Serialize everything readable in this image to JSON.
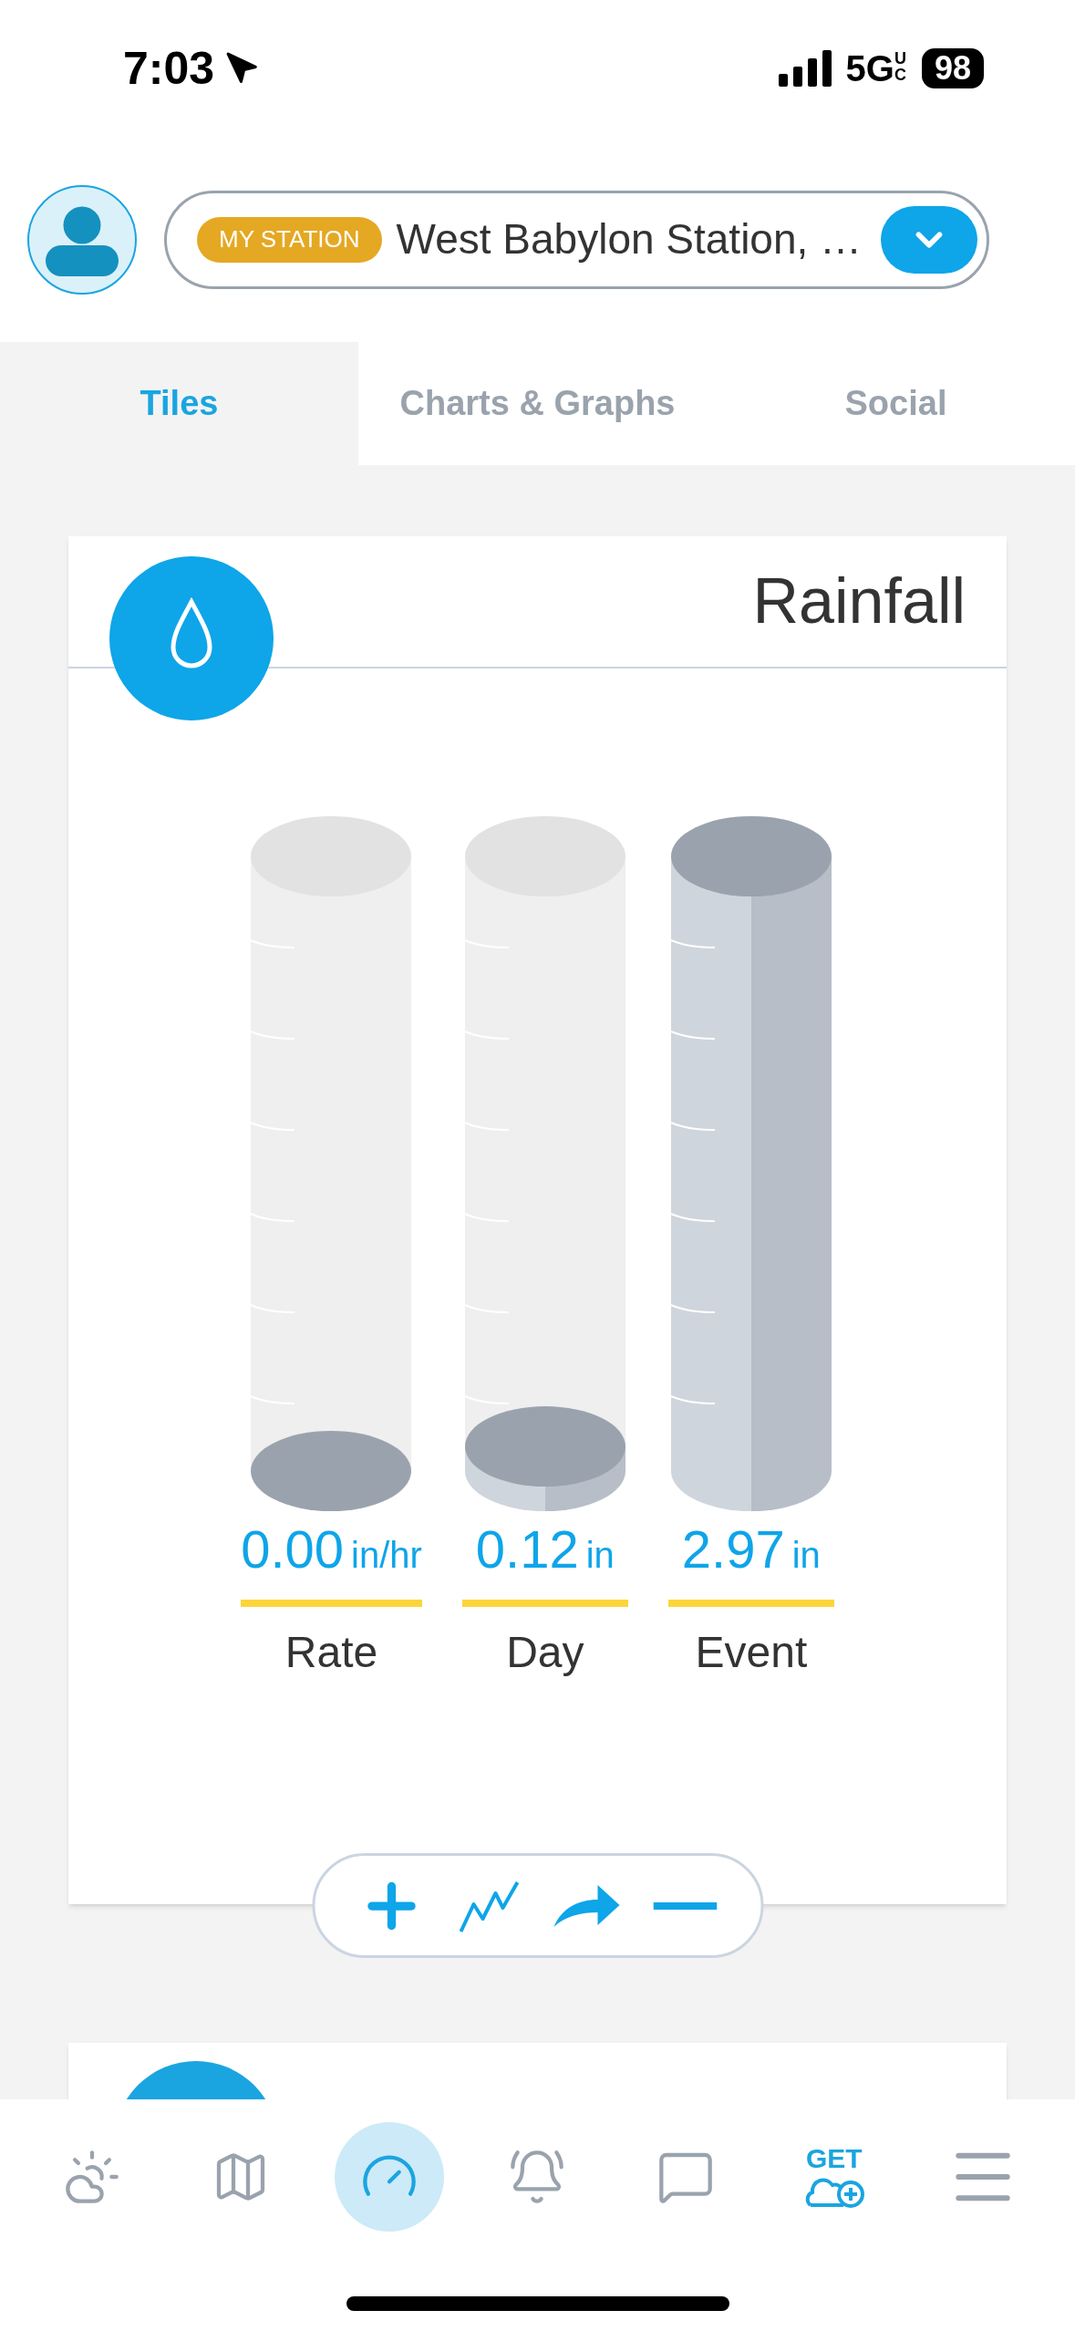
{
  "status_bar": {
    "time": "7:03",
    "network": "5G",
    "network_suffix": "UC",
    "battery": "98"
  },
  "header": {
    "badge": "MY STATION",
    "station": "West Babylon Station, …"
  },
  "tabs": [
    {
      "label": "Tiles",
      "selected": true
    },
    {
      "label": "Charts & Graphs",
      "selected": false
    },
    {
      "label": "Social",
      "selected": false
    }
  ],
  "tile": {
    "title": "Rainfall",
    "gauges": [
      {
        "value": "0.00",
        "unit": "in/hr",
        "label": "Rate",
        "level": 0
      },
      {
        "value": "0.12",
        "unit": "in",
        "label": "Day",
        "level": 0.04
      },
      {
        "value": "2.97",
        "unit": "in",
        "label": "Event",
        "level": 1
      }
    ]
  },
  "nav": [
    {
      "kind": "weather",
      "selected": false
    },
    {
      "kind": "map",
      "selected": false
    },
    {
      "kind": "dashboard",
      "selected": true
    },
    {
      "kind": "alerts",
      "selected": false
    },
    {
      "kind": "messages",
      "selected": false
    },
    {
      "kind": "get",
      "label": "GET",
      "selected": false
    },
    {
      "kind": "menu",
      "selected": false
    }
  ]
}
